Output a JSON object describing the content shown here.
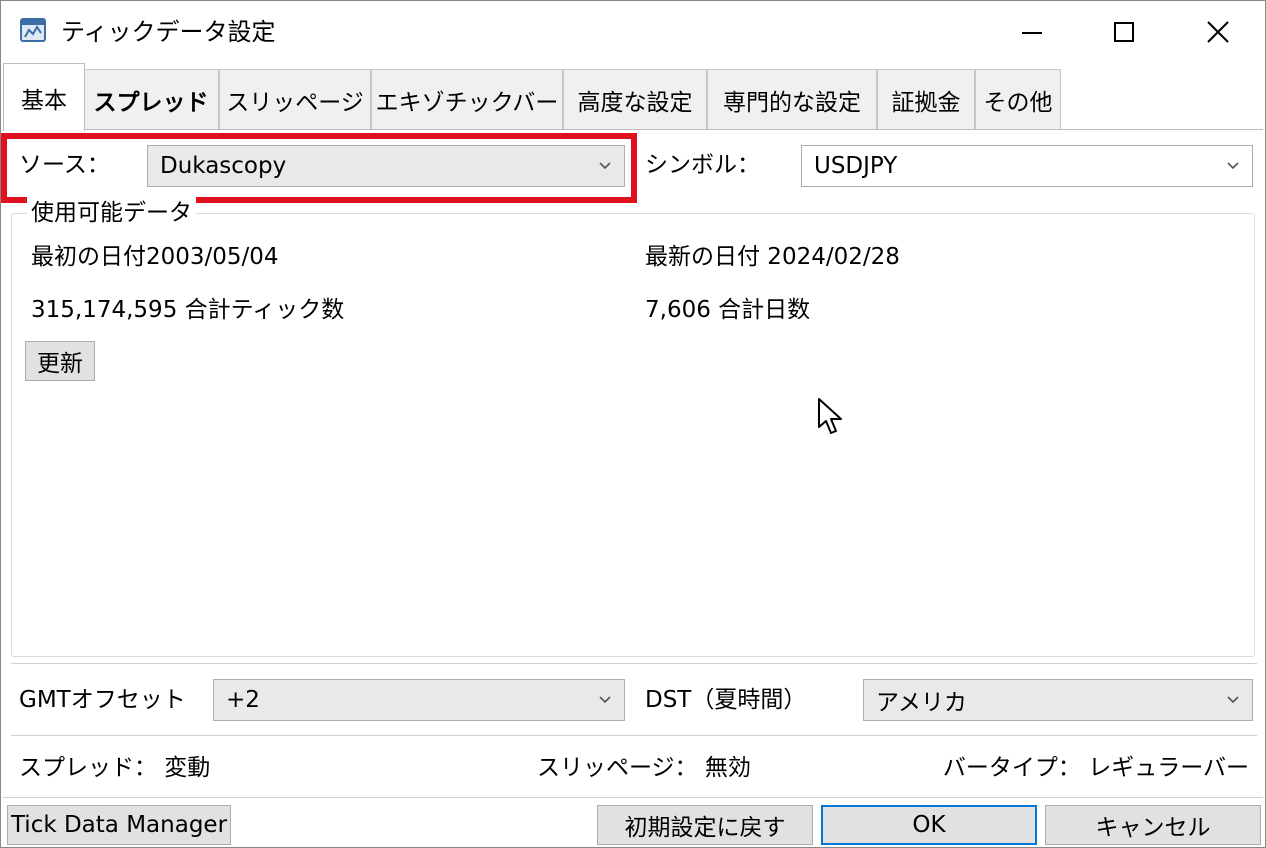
{
  "window": {
    "title": "ティックデータ設定"
  },
  "tabs": [
    {
      "label": "基本"
    },
    {
      "label": "スプレッド"
    },
    {
      "label": "スリッページ"
    },
    {
      "label": "エキゾチックバー"
    },
    {
      "label": "高度な設定"
    },
    {
      "label": "専門的な設定"
    },
    {
      "label": "証拠金"
    },
    {
      "label": "その他"
    }
  ],
  "source": {
    "label": "ソース：",
    "value": "Dukascopy"
  },
  "symbol": {
    "label": "シンボル：",
    "value": "USDJPY"
  },
  "available_data": {
    "legend": "使用可能データ",
    "first_date": "最初の日付2003/05/04",
    "last_date": "最新の日付 2024/02/28",
    "total_ticks": "315,174,595 合計ティック数",
    "total_days": "7,606 合計日数",
    "refresh_label": "更新"
  },
  "gmt_offset": {
    "label": "GMTオフセット",
    "value": "+2"
  },
  "dst": {
    "label": "DST（夏時間）",
    "value": "アメリカ"
  },
  "status": {
    "spread": "スプレッド：  変動",
    "slippage": "スリッページ：  無効",
    "bar_type": "バータイプ：  レギュラーバー"
  },
  "buttons": {
    "tick_data_manager": "Tick Data Manager",
    "reset": "初期設定に戻す",
    "ok": "OK",
    "cancel": "キャンセル"
  },
  "highlight_color": "#e0121f"
}
